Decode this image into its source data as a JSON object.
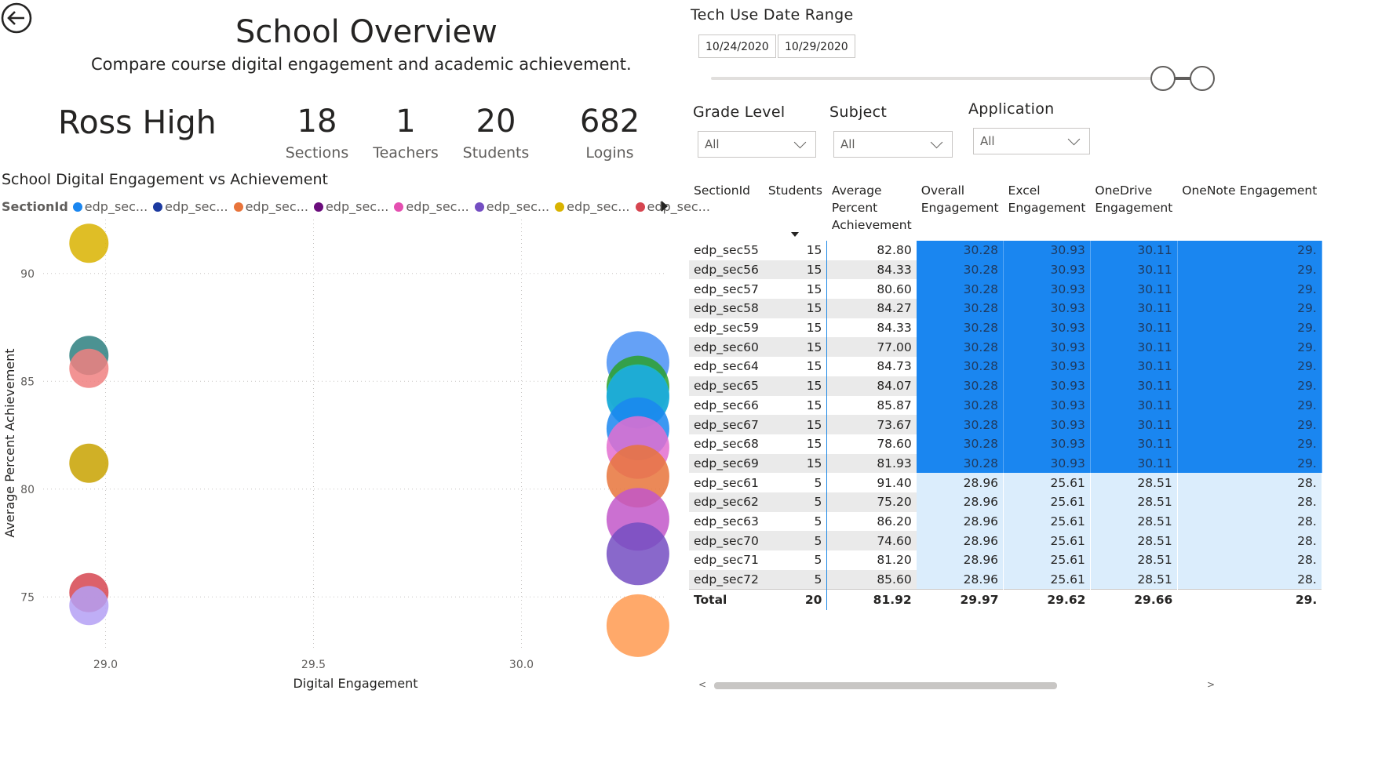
{
  "header": {
    "title": "School Overview",
    "subtitle": "Compare course digital engagement and academic achievement.",
    "school_name": "Ross High"
  },
  "kpis": [
    {
      "value": "18",
      "label": "Sections"
    },
    {
      "value": "1",
      "label": "Teachers"
    },
    {
      "value": "20",
      "label": "Students"
    },
    {
      "value": "682",
      "label": "Logins"
    }
  ],
  "chart": {
    "title": "School Digital Engagement vs Achievement",
    "legend_title": "SectionId",
    "legend_items": [
      {
        "label": "edp_sec...",
        "color": "#1a86f0"
      },
      {
        "label": "edp_sec...",
        "color": "#1c3aa0"
      },
      {
        "label": "edp_sec...",
        "color": "#e8743b"
      },
      {
        "label": "edp_sec...",
        "color": "#6b0d7c"
      },
      {
        "label": "edp_sec...",
        "color": "#e44fb0"
      },
      {
        "label": "edp_sec...",
        "color": "#744ec2"
      },
      {
        "label": "edp_sec...",
        "color": "#d9b300"
      },
      {
        "label": "edp_sec...",
        "color": "#d64550"
      }
    ]
  },
  "chart_data": {
    "type": "scatter",
    "title": "School Digital Engagement vs Achievement",
    "xlabel": "Digital Engagement",
    "ylabel": "Average Percent Achievement",
    "xlim": [
      28.85,
      30.35
    ],
    "ylim": [
      72.5,
      92.5
    ],
    "xticks": [
      "29.0",
      "29.5",
      "30.0"
    ],
    "yticks": [
      "75",
      "80",
      "85",
      "90"
    ],
    "grid": true,
    "legend_position": "top",
    "points": [
      {
        "x": 28.96,
        "y": 91.4,
        "color": "#d9b300"
      },
      {
        "x": 28.96,
        "y": 86.2,
        "color": "#2d7f7f"
      },
      {
        "x": 28.96,
        "y": 85.6,
        "color": "#f08080"
      },
      {
        "x": 28.96,
        "y": 81.2,
        "color": "#c8a200"
      },
      {
        "x": 28.96,
        "y": 75.2,
        "color": "#d64550"
      },
      {
        "x": 28.96,
        "y": 74.6,
        "color": "#b4a0f5"
      },
      {
        "x": 30.28,
        "y": 85.87,
        "color": "#4a90f5"
      },
      {
        "x": 30.28,
        "y": 84.73,
        "color": "#2ca02c"
      },
      {
        "x": 30.28,
        "y": 84.33,
        "color": "#17bcd4"
      },
      {
        "x": 30.28,
        "y": 84.27,
        "color": "#1ea9d8"
      },
      {
        "x": 30.28,
        "y": 82.8,
        "color": "#1a86f0"
      },
      {
        "x": 30.28,
        "y": 81.93,
        "color": "#e36fd0"
      },
      {
        "x": 30.28,
        "y": 80.6,
        "color": "#e8743b"
      },
      {
        "x": 30.28,
        "y": 78.6,
        "color": "#c257c9"
      },
      {
        "x": 30.28,
        "y": 77.0,
        "color": "#744ec2"
      },
      {
        "x": 30.28,
        "y": 73.67,
        "color": "#ff9a50"
      }
    ]
  },
  "filters": {
    "date_range_label": "Tech Use Date Range",
    "date_start": "10/24/2020",
    "date_end": "10/29/2020",
    "grade_label": "Grade Level",
    "grade_value": "All",
    "subject_label": "Subject",
    "subject_value": "All",
    "application_label": "Application",
    "application_value": "All"
  },
  "table": {
    "headers": [
      "SectionId",
      "Students",
      "Average Percent Achievement",
      "Overall Engagement",
      "Excel Engagement",
      "OneDrive Engagement",
      "OneNote Engagement"
    ],
    "rows": [
      [
        "edp_sec55",
        "15",
        "82.80",
        "30.28",
        "30.93",
        "30.11",
        "29."
      ],
      [
        "edp_sec56",
        "15",
        "84.33",
        "30.28",
        "30.93",
        "30.11",
        "29."
      ],
      [
        "edp_sec57",
        "15",
        "80.60",
        "30.28",
        "30.93",
        "30.11",
        "29."
      ],
      [
        "edp_sec58",
        "15",
        "84.27",
        "30.28",
        "30.93",
        "30.11",
        "29."
      ],
      [
        "edp_sec59",
        "15",
        "84.33",
        "30.28",
        "30.93",
        "30.11",
        "29."
      ],
      [
        "edp_sec60",
        "15",
        "77.00",
        "30.28",
        "30.93",
        "30.11",
        "29."
      ],
      [
        "edp_sec64",
        "15",
        "84.73",
        "30.28",
        "30.93",
        "30.11",
        "29."
      ],
      [
        "edp_sec65",
        "15",
        "84.07",
        "30.28",
        "30.93",
        "30.11",
        "29."
      ],
      [
        "edp_sec66",
        "15",
        "85.87",
        "30.28",
        "30.93",
        "30.11",
        "29."
      ],
      [
        "edp_sec67",
        "15",
        "73.67",
        "30.28",
        "30.93",
        "30.11",
        "29."
      ],
      [
        "edp_sec68",
        "15",
        "78.60",
        "30.28",
        "30.93",
        "30.11",
        "29."
      ],
      [
        "edp_sec69",
        "15",
        "81.93",
        "30.28",
        "30.93",
        "30.11",
        "29."
      ],
      [
        "edp_sec61",
        "5",
        "91.40",
        "28.96",
        "25.61",
        "28.51",
        "28."
      ],
      [
        "edp_sec62",
        "5",
        "75.20",
        "28.96",
        "25.61",
        "28.51",
        "28."
      ],
      [
        "edp_sec63",
        "5",
        "86.20",
        "28.96",
        "25.61",
        "28.51",
        "28."
      ],
      [
        "edp_sec70",
        "5",
        "74.60",
        "28.96",
        "25.61",
        "28.51",
        "28."
      ],
      [
        "edp_sec71",
        "5",
        "81.20",
        "28.96",
        "25.61",
        "28.51",
        "28."
      ],
      [
        "edp_sec72",
        "5",
        "85.60",
        "28.96",
        "25.61",
        "28.51",
        "28."
      ]
    ],
    "total": [
      "Total",
      "20",
      "81.92",
      "29.97",
      "29.62",
      "29.66",
      "29."
    ]
  }
}
